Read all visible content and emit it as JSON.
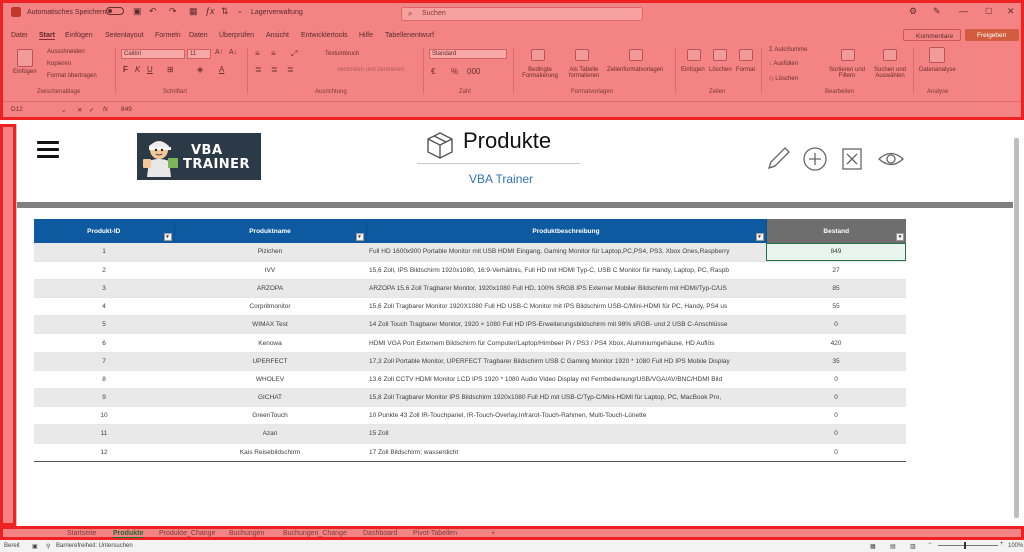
{
  "titlebar": {
    "autosave_label": "Automatisches Speichern",
    "toggle_state": "Aus",
    "filename": "Lagerverwaltung",
    "search_placeholder": "Suchen"
  },
  "menu": {
    "items": [
      "Datei",
      "Start",
      "Einfügen",
      "Seitenlayout",
      "Formeln",
      "Daten",
      "Überprüfen",
      "Ansicht",
      "Entwicklertools",
      "Hilfe",
      "Tabellenentwurf"
    ],
    "active": "Start",
    "comments_label": "Kommentare",
    "share_label": "Freigeben"
  },
  "ribbon": {
    "clipboard": {
      "paste": "Einfügen",
      "cut": "Ausschneiden",
      "copy": "Kopieren",
      "format_painter": "Format übertragen",
      "group": "Zwischenablage"
    },
    "font": {
      "name": "Calibri",
      "size": "11",
      "group": "Schriftart"
    },
    "alignment": {
      "wrap": "Textumbruch",
      "merge": "Verbinden und zentrieren",
      "group": "Ausrichtung"
    },
    "number": {
      "format": "Standard",
      "group": "Zahl"
    },
    "styles": {
      "cond": "Bedingte Formatierung",
      "as_table": "Als Tabelle formatieren",
      "cell_styles": "Zellenformatvorlagen",
      "group": "Formatvorlagen"
    },
    "cells": {
      "insert": "Einfügen",
      "delete": "Löschen",
      "format": "Format",
      "group": "Zellen"
    },
    "editing": {
      "autosum": "AutoSumme",
      "fill": "Ausfüllen",
      "clear": "Löschen",
      "sort": "Sortieren und Filtern",
      "find": "Suchen und Auswählen",
      "group": "Bearbeiten"
    },
    "analysis": {
      "analyze": "Datenanalyse",
      "group": "Analyse"
    }
  },
  "formulabar": {
    "cell_ref": "D12",
    "fx": "fx",
    "value": "849"
  },
  "header": {
    "title": "Produkte",
    "subtitle": "VBA Trainer",
    "logo_line1": "VBA",
    "logo_line2": "TRAINER"
  },
  "table": {
    "columns": [
      "Produkt-ID",
      "Produktname",
      "Produktbeschreibung",
      "Bestand"
    ],
    "rows": [
      [
        "1",
        "Pizichen",
        "Full HD 1600x900 Portable Monitor mit USB HDMI Eingang, Gaming Monitor für Laptop,PC,PS4, PS3, Xbox Ones,Raspberry",
        "849"
      ],
      [
        "2",
        "IVV",
        "15,6 Zoll, IPS Bildschirm 1920x1080, 16:9-Verhältnis, Full HD mit HDMI Typ-C, USB C Monitor für Handy, Laptop, PC, Raspb",
        "27"
      ],
      [
        "3",
        "ARZOPA",
        "ARZOPA 15.6 Zoll Tragbarer Monitor, 1920x1080 Full HD, 100% SRGB IPS Externer Mobiler Bildschirm mit HDMI/Typ-C/US",
        "85"
      ],
      [
        "4",
        "Corpritmonitor",
        "15,6 Zoll Tragbarer Monitor 1920X1080 Full HD USB-C Monitor mit IPS Bildschirm USB-C/Mini-HDMI für PC, Handy, PS4 us",
        "55"
      ],
      [
        "5",
        "WIMAX Test",
        "14 Zoll Touch Tragbarer Monitor, 1920 × 1080 Full HD IPS-Erweiterungsbildschirm mit 98% sRGB- und 2 USB C-Anschlüsse",
        "0"
      ],
      [
        "6",
        "Kenowa",
        "HDMI VGA Port Externem Bildschirm für Computer/Laptop/Himbeer Pi / PS3 / PS4 Xbox, Aluminiumgehäuse, HD Auflös",
        "420"
      ],
      [
        "7",
        "UPERFECT",
        "17,3 Zoll Portable Monitor, UPERFECT Tragbarer Bildschirm USB C Gaming Monitor 1920 * 1080 Full HD IPS Mobile Display",
        "35"
      ],
      [
        "8",
        "WHOLEV",
        "13.6 Zoll CCTV HDMI Monitor LCD IPS 1920 * 1080 Audio Video Display mit Fernbedienung/USB/VGA/AV/BNC/HDMI Bild",
        "0"
      ],
      [
        "9",
        "GICHAT",
        "15,8 Zoll Tragbarer Monitor IPS Bildschirm 1920x1080 Full HD mit USB-C/Typ-C/Mini-HDMI für Laptop, PC, MacBook Pro,",
        "0"
      ],
      [
        "10",
        "GreenTouch",
        "10 Punkte 43 Zoll IR-Touchpanel, IR-Touch-Overlay,Infrarot-Touch-Rahmen, Multi-Touch-Lünette",
        "0"
      ],
      [
        "11",
        "Azari",
        "15 Zoll",
        "0"
      ],
      [
        "12",
        "Kais Reisebildschirm",
        "17 Zoll Bildschirm; wasserdicht",
        "0"
      ]
    ]
  },
  "sheet_tabs": {
    "items": [
      "Startseite",
      "Produkte",
      "Produkte_Change",
      "Buchungen",
      "Buchungen_Change",
      "Dashboard",
      "Pivot-Tabellen",
      "+"
    ],
    "active": "Produkte"
  },
  "status": {
    "ready": "Bereit",
    "accessibility": "Barrierefreiheit: Untersuchen",
    "zoom": "100%"
  },
  "colors": {
    "table_header": "#0e5aa0",
    "stock_header": "#6e6e6e",
    "accent_blue": "#2f75b5",
    "overlay_red": "#f48484"
  }
}
